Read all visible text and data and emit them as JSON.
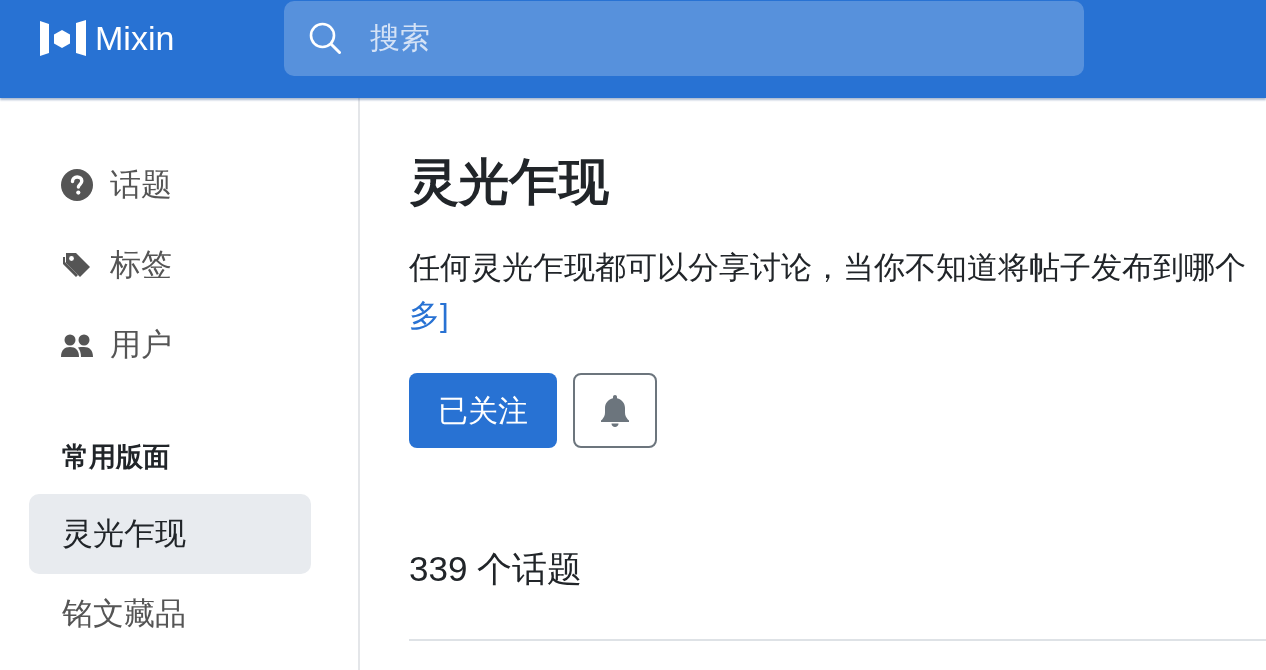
{
  "navbar": {
    "logo_text": "Mixin",
    "search": {
      "placeholder": "搜索"
    }
  },
  "sidebar": {
    "nav_items": [
      {
        "kind": "topics",
        "label": "话题"
      },
      {
        "kind": "tags",
        "label": "标签"
      },
      {
        "kind": "users",
        "label": "用户"
      }
    ],
    "section_title": "常用版面",
    "boards": [
      {
        "label": "灵光乍现",
        "selected": true
      },
      {
        "label": "铭文藏品",
        "selected": false
      }
    ]
  },
  "main": {
    "title": "灵光乍现",
    "description": "任何灵光乍现都可以分享讨论，当你不知道将帖子发布到哪个",
    "more_link": "多]",
    "follow_button": {
      "label": "已关注"
    },
    "topic_count": "339 个话题"
  }
}
